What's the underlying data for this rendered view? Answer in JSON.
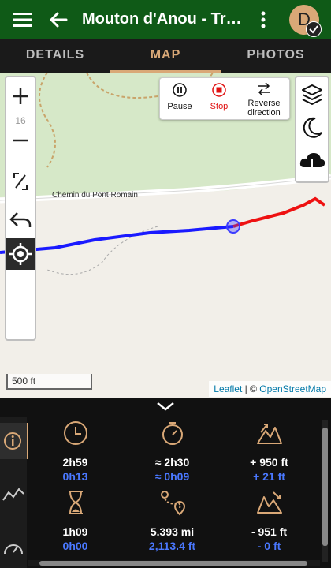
{
  "appbar": {
    "title": "Mouton d'Anou - Tracé",
    "avatar_letter": "D"
  },
  "tabs": [
    {
      "label": "DETAILS"
    },
    {
      "label": "MAP"
    },
    {
      "label": "PHOTOS"
    }
  ],
  "map": {
    "zoom_level": "16",
    "road_label": "Chemin du Pont Romain",
    "actions": {
      "pause": "Pause",
      "stop": "Stop",
      "reverse_line1": "Reverse",
      "reverse_line2": "direction"
    },
    "scale": "500 ft",
    "attribution": {
      "leaflet": "Leaflet",
      "sep": " | © ",
      "osm": "OpenStreetMap"
    },
    "colors": {
      "track_done": "#1a1aff",
      "track_remaining": "#ee1111",
      "forest": "#d6e8c8",
      "road": "#ffffff"
    }
  },
  "stats": [
    {
      "icon": "clock-icon",
      "primary": "2h59",
      "secondary": "0h13"
    },
    {
      "icon": "stopwatch-icon",
      "primary": "≈ 2h30",
      "secondary": "≈ 0h09"
    },
    {
      "icon": "ascent-icon",
      "primary": "+ 950 ft",
      "secondary": "+ 21 ft"
    },
    {
      "icon": "hourglass-icon",
      "primary": "1h09",
      "secondary": "0h00"
    },
    {
      "icon": "route-distance-icon",
      "primary": "5.393 mi",
      "secondary": "2,113.4 ft"
    },
    {
      "icon": "descent-icon",
      "primary": "- 951 ft",
      "secondary": "- 0 ft"
    }
  ],
  "accent": "#d9a877",
  "secondary_value_color": "#4a78ff"
}
